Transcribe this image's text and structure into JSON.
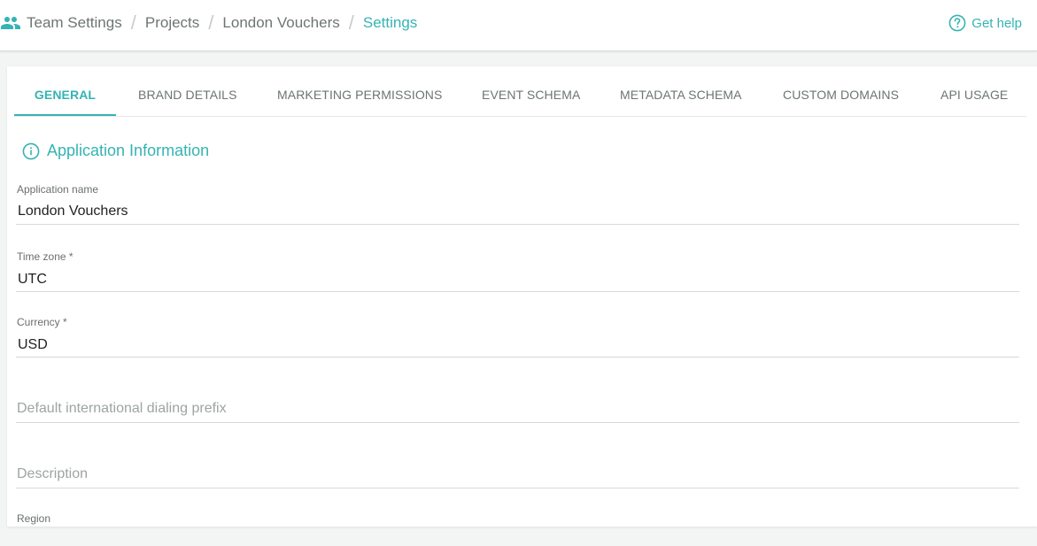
{
  "breadcrumb": {
    "items": [
      "Team Settings",
      "Projects",
      "London Vouchers",
      "Settings"
    ],
    "separator": "/"
  },
  "help": {
    "label": "Get help"
  },
  "tabs": [
    {
      "label": "GENERAL",
      "active": true
    },
    {
      "label": "BRAND DETAILS"
    },
    {
      "label": "MARKETING PERMISSIONS"
    },
    {
      "label": "EVENT SCHEMA"
    },
    {
      "label": "METADATA SCHEMA"
    },
    {
      "label": "CUSTOM DOMAINS"
    },
    {
      "label": "API USAGE"
    }
  ],
  "section": {
    "title": "Application Information"
  },
  "fields": {
    "app_name": {
      "label": "Application name",
      "value": "London Vouchers"
    },
    "time_zone": {
      "label": "Time zone *",
      "value": "UTC"
    },
    "currency": {
      "label": "Currency *",
      "value": "USD"
    },
    "dialing_prefix": {
      "placeholder": "Default international dialing prefix"
    },
    "description": {
      "placeholder": "Description"
    },
    "region": {
      "label": "Region"
    }
  },
  "colors": {
    "accent": "#36b3b3",
    "background": "#f3f4f4"
  }
}
